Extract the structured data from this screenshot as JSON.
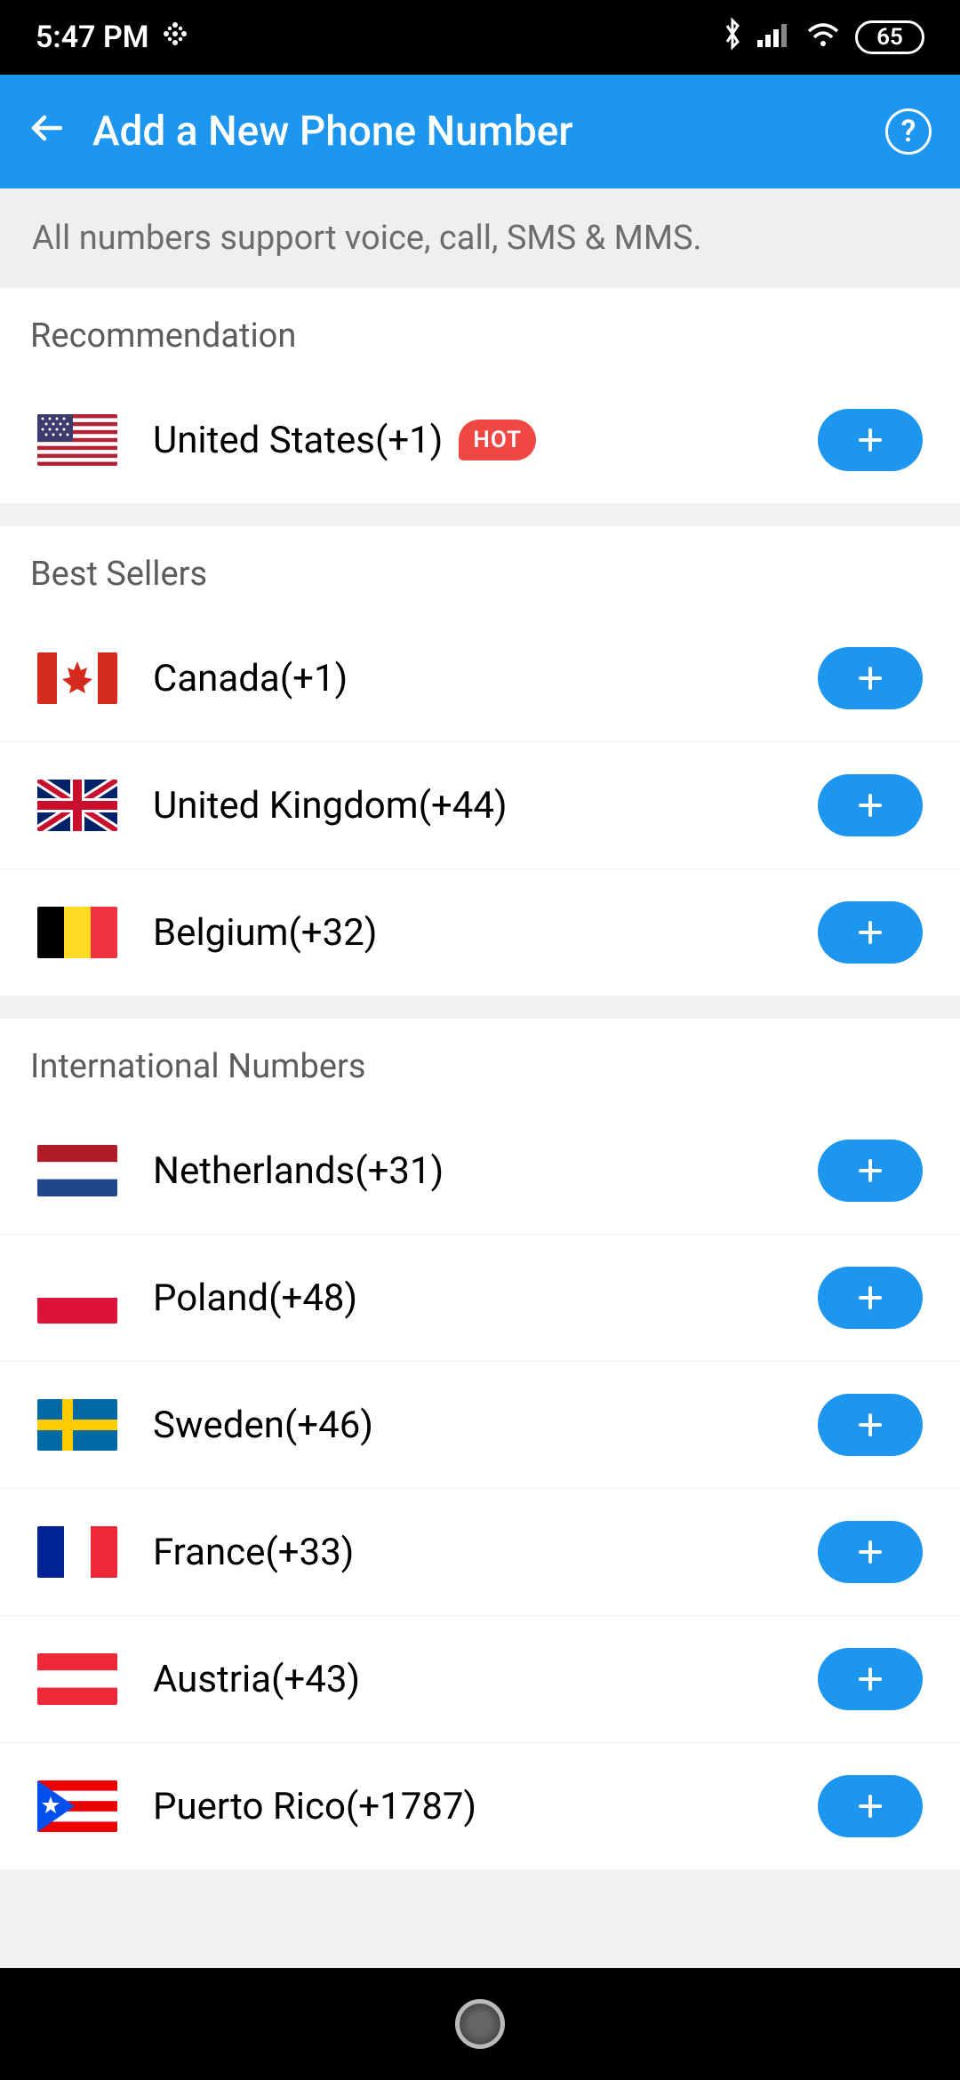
{
  "status": {
    "time": "5:47 PM",
    "battery": "65"
  },
  "header": {
    "title": "Add a New Phone Number"
  },
  "info": "All numbers support voice, call, SMS & MMS.",
  "sections": {
    "recommendation_title": "Recommendation",
    "best_sellers_title": "Best Sellers",
    "international_title": "International Numbers"
  },
  "countries": {
    "us": {
      "label": "United States(+1)",
      "badge": "HOT"
    },
    "ca": {
      "label": "Canada(+1)"
    },
    "uk": {
      "label": "United Kingdom(+44)"
    },
    "be": {
      "label": "Belgium(+32)"
    },
    "nl": {
      "label": "Netherlands(+31)"
    },
    "pl": {
      "label": "Poland(+48)"
    },
    "se": {
      "label": "Sweden(+46)"
    },
    "fr": {
      "label": "France(+33)"
    },
    "at": {
      "label": "Austria(+43)"
    },
    "pr": {
      "label": "Puerto Rico(+1787)"
    }
  }
}
